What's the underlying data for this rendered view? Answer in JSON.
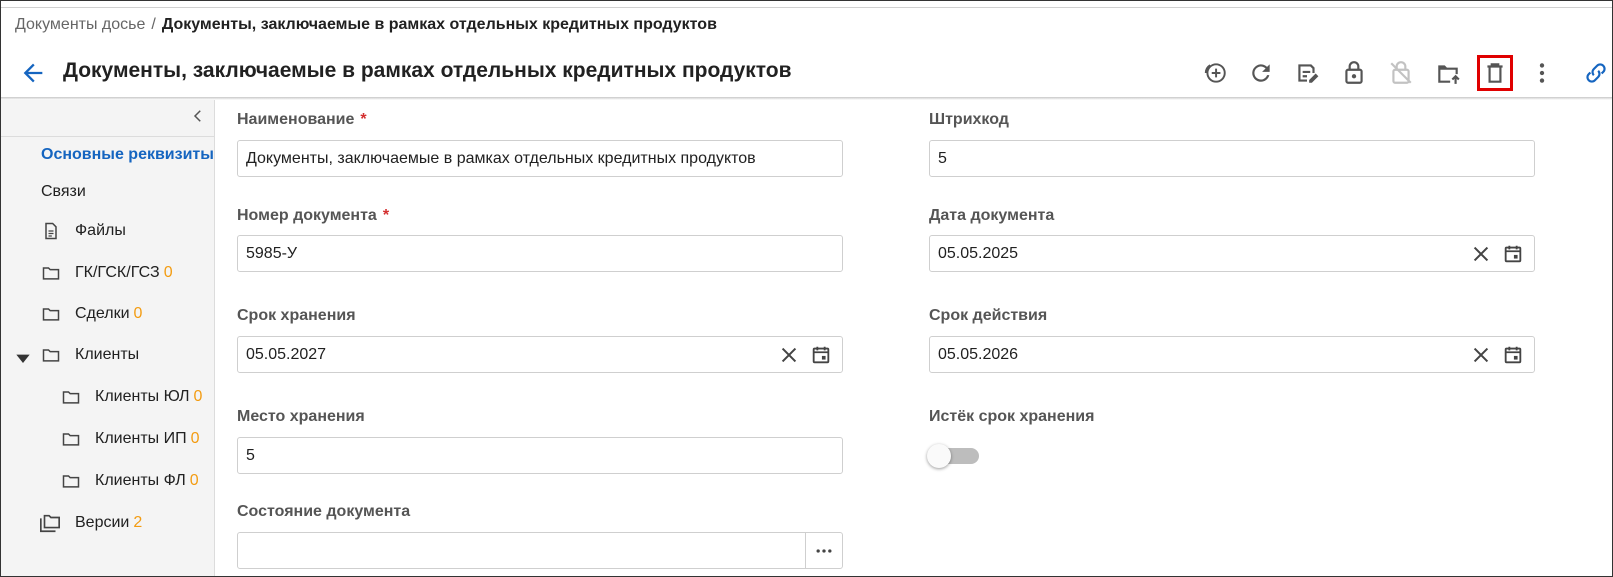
{
  "breadcrumb": {
    "parent": "Документы досье",
    "separator": "/",
    "current": "Документы, заключаемые в рамках отдельных кредитных продуктов"
  },
  "header": {
    "title": "Документы, заключаемые в рамках отдельных кредитных продуктов",
    "back_icon": "arrow-left-icon",
    "accent_color": "#1565c0"
  },
  "toolbar": {
    "buttons": [
      {
        "icon": "add-circle-icon"
      },
      {
        "icon": "refresh-icon"
      },
      {
        "icon": "save-edit-icon"
      },
      {
        "icon": "lock-open-icon"
      },
      {
        "icon": "lock-disabled-icon"
      },
      {
        "icon": "folder-upload-icon"
      },
      {
        "icon": "delete-icon",
        "highlighted": true
      },
      {
        "icon": "more-vertical-icon"
      },
      {
        "icon": "link-icon"
      }
    ]
  },
  "sidebar": {
    "items": [
      {
        "label": "Основные реквизиты",
        "active": true
      },
      {
        "label": "Связи"
      },
      {
        "label": "Файлы",
        "icon": "file-icon"
      },
      {
        "label": "ГК/ГСК/ГСЗ",
        "count": "0",
        "icon": "folder-icon"
      },
      {
        "label": "Сделки",
        "count": "0",
        "icon": "folder-icon"
      },
      {
        "label": "Клиенты",
        "icon": "folder-icon",
        "expanded": true
      },
      {
        "label": "Клиенты ЮЛ",
        "count": "0",
        "icon": "folder-icon"
      },
      {
        "label": "Клиенты ИП",
        "count": "0",
        "icon": "folder-icon"
      },
      {
        "label": "Клиенты ФЛ",
        "count": "0",
        "icon": "folder-icon"
      },
      {
        "label": "Версии",
        "count": "2",
        "icon": "versions-icon"
      }
    ],
    "count_color": "#f39c12"
  },
  "form": {
    "name": {
      "label": "Наименование",
      "required_mark": "*",
      "value": "Документы, заключаемые в рамках отдельных кредитных продуктов"
    },
    "barcode": {
      "label": "Штрихкод",
      "value": "5"
    },
    "doc_number": {
      "label": "Номер документа",
      "required_mark": "*",
      "value": "5985-У"
    },
    "doc_date": {
      "label": "Дата документа",
      "value": "05.05.2025"
    },
    "storage_period": {
      "label": "Срок хранения",
      "value": "05.05.2027"
    },
    "validity_period": {
      "label": "Срок действия",
      "value": "05.05.2026"
    },
    "storage_place": {
      "label": "Место хранения",
      "value": "5"
    },
    "storage_expired": {
      "label": "Истёк срок хранения",
      "on": false
    },
    "doc_state": {
      "label": "Состояние документа",
      "value": ""
    }
  }
}
